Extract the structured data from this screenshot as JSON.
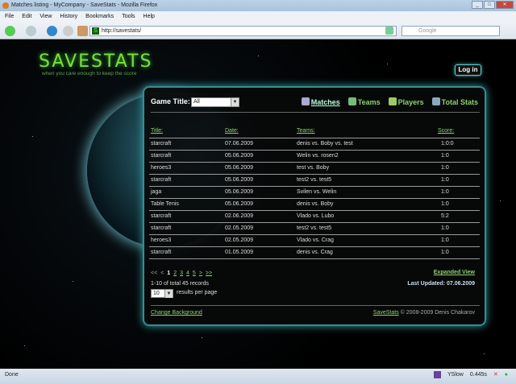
{
  "window": {
    "title": "Matches listing - MyCompany - SaveStats - Mozilla Firefox"
  },
  "menu": [
    "File",
    "Edit",
    "View",
    "History",
    "Bookmarks",
    "Tools",
    "Help"
  ],
  "nav": {
    "url": "http://savestats/",
    "search_placeholder": "Google"
  },
  "site": {
    "logo": "SAVESTATS",
    "tagline": "when you care enough to keep the score",
    "login": "Log in"
  },
  "filter": {
    "label": "Game Title:",
    "value": "All"
  },
  "tabs": [
    {
      "label": "Matches",
      "active": true
    },
    {
      "label": "Teams"
    },
    {
      "label": "Players"
    },
    {
      "label": "Total Stats"
    }
  ],
  "table": {
    "headers": [
      "Title:",
      "Date:",
      "Teams:",
      "Score:"
    ],
    "rows": [
      [
        "starcraft",
        "07.06.2009",
        "denis vs. Boby vs. test",
        "1:0:0"
      ],
      [
        "starcraft",
        "05.06.2009",
        "Welin vs. rosen2",
        "1:0"
      ],
      [
        "heroes3",
        "05.06.2009",
        "test vs. Boby",
        "1:0"
      ],
      [
        "starcraft",
        "05.06.2009",
        "test2 vs. test5",
        "1:0"
      ],
      [
        "jaga",
        "05.06.2009",
        "Svilen vs. Welin",
        "1:0"
      ],
      [
        "Table Tenis",
        "05.06.2009",
        "denis vs. Boby",
        "1:0"
      ],
      [
        "starcraft",
        "02.06.2009",
        "Vlado vs. Lubo",
        "5:2"
      ],
      [
        "starcraft",
        "02.05.2009",
        "test2 vs. test5",
        "1:0"
      ],
      [
        "heroes3",
        "02.05.2009",
        "Vlado vs. Crag",
        "1:0"
      ],
      [
        "starcraft",
        "01.05.2009",
        "denis vs. Crag",
        "1:0"
      ]
    ]
  },
  "pager": {
    "first": "<<",
    "prev": "<",
    "pages": [
      "1",
      "2",
      "3",
      "4",
      "5"
    ],
    "next": ">",
    "last": ">>",
    "records": "1-10 of total 45 records",
    "per_page": "10",
    "per_page_label": "results per page"
  },
  "expanded_view": "Expanded View",
  "last_updated": "Last Updated: 07.06.2009",
  "footer": {
    "change_bg": "Change Background",
    "brand": "SaveStats",
    "copyright": "© 2008-2009 Denis Chakarov"
  },
  "statusbar": {
    "text": "Done",
    "yslow": "YSlow",
    "time": "0.445s"
  }
}
